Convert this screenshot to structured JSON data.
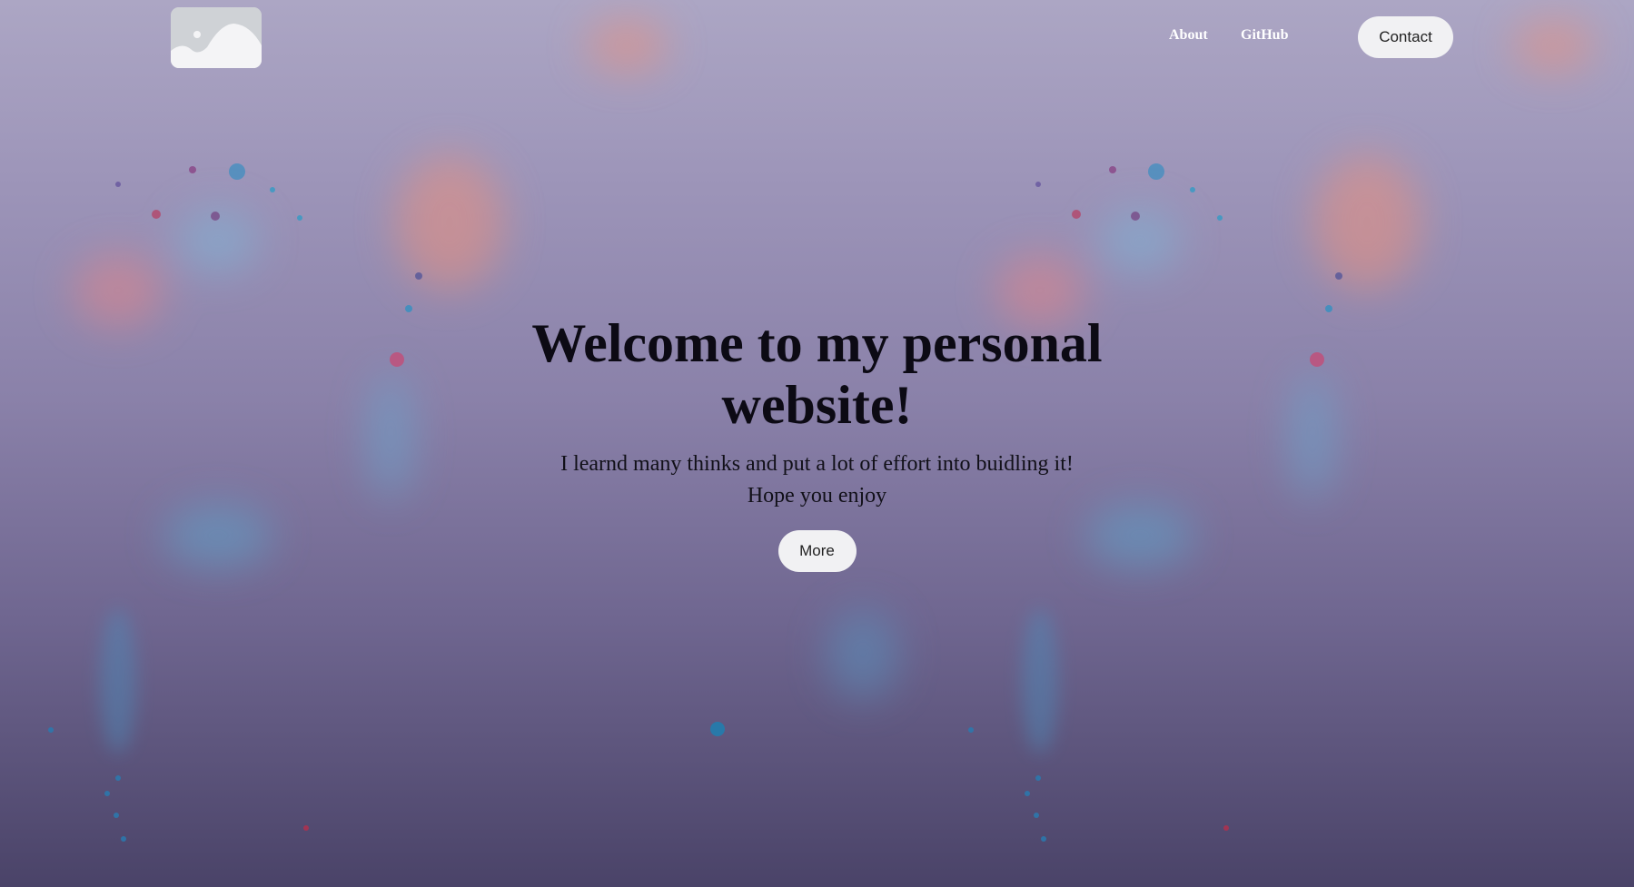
{
  "nav": {
    "logo_icon": "image-placeholder-icon",
    "links": [
      {
        "label": "About"
      },
      {
        "label": "GitHub"
      }
    ],
    "contact_label": "Contact"
  },
  "hero": {
    "title": "Welcome to my personal website!",
    "subtitle": "I learnd many thinks and put a lot of effort into buidling it! Hope you enjoy",
    "more_label": "More"
  },
  "colors": {
    "background_top": "#aca6c4",
    "background_bottom": "#4a4368",
    "button_bg": "#f1f1f3",
    "heading_text": "#0c0a14",
    "nav_link_text": "#ffffff"
  }
}
